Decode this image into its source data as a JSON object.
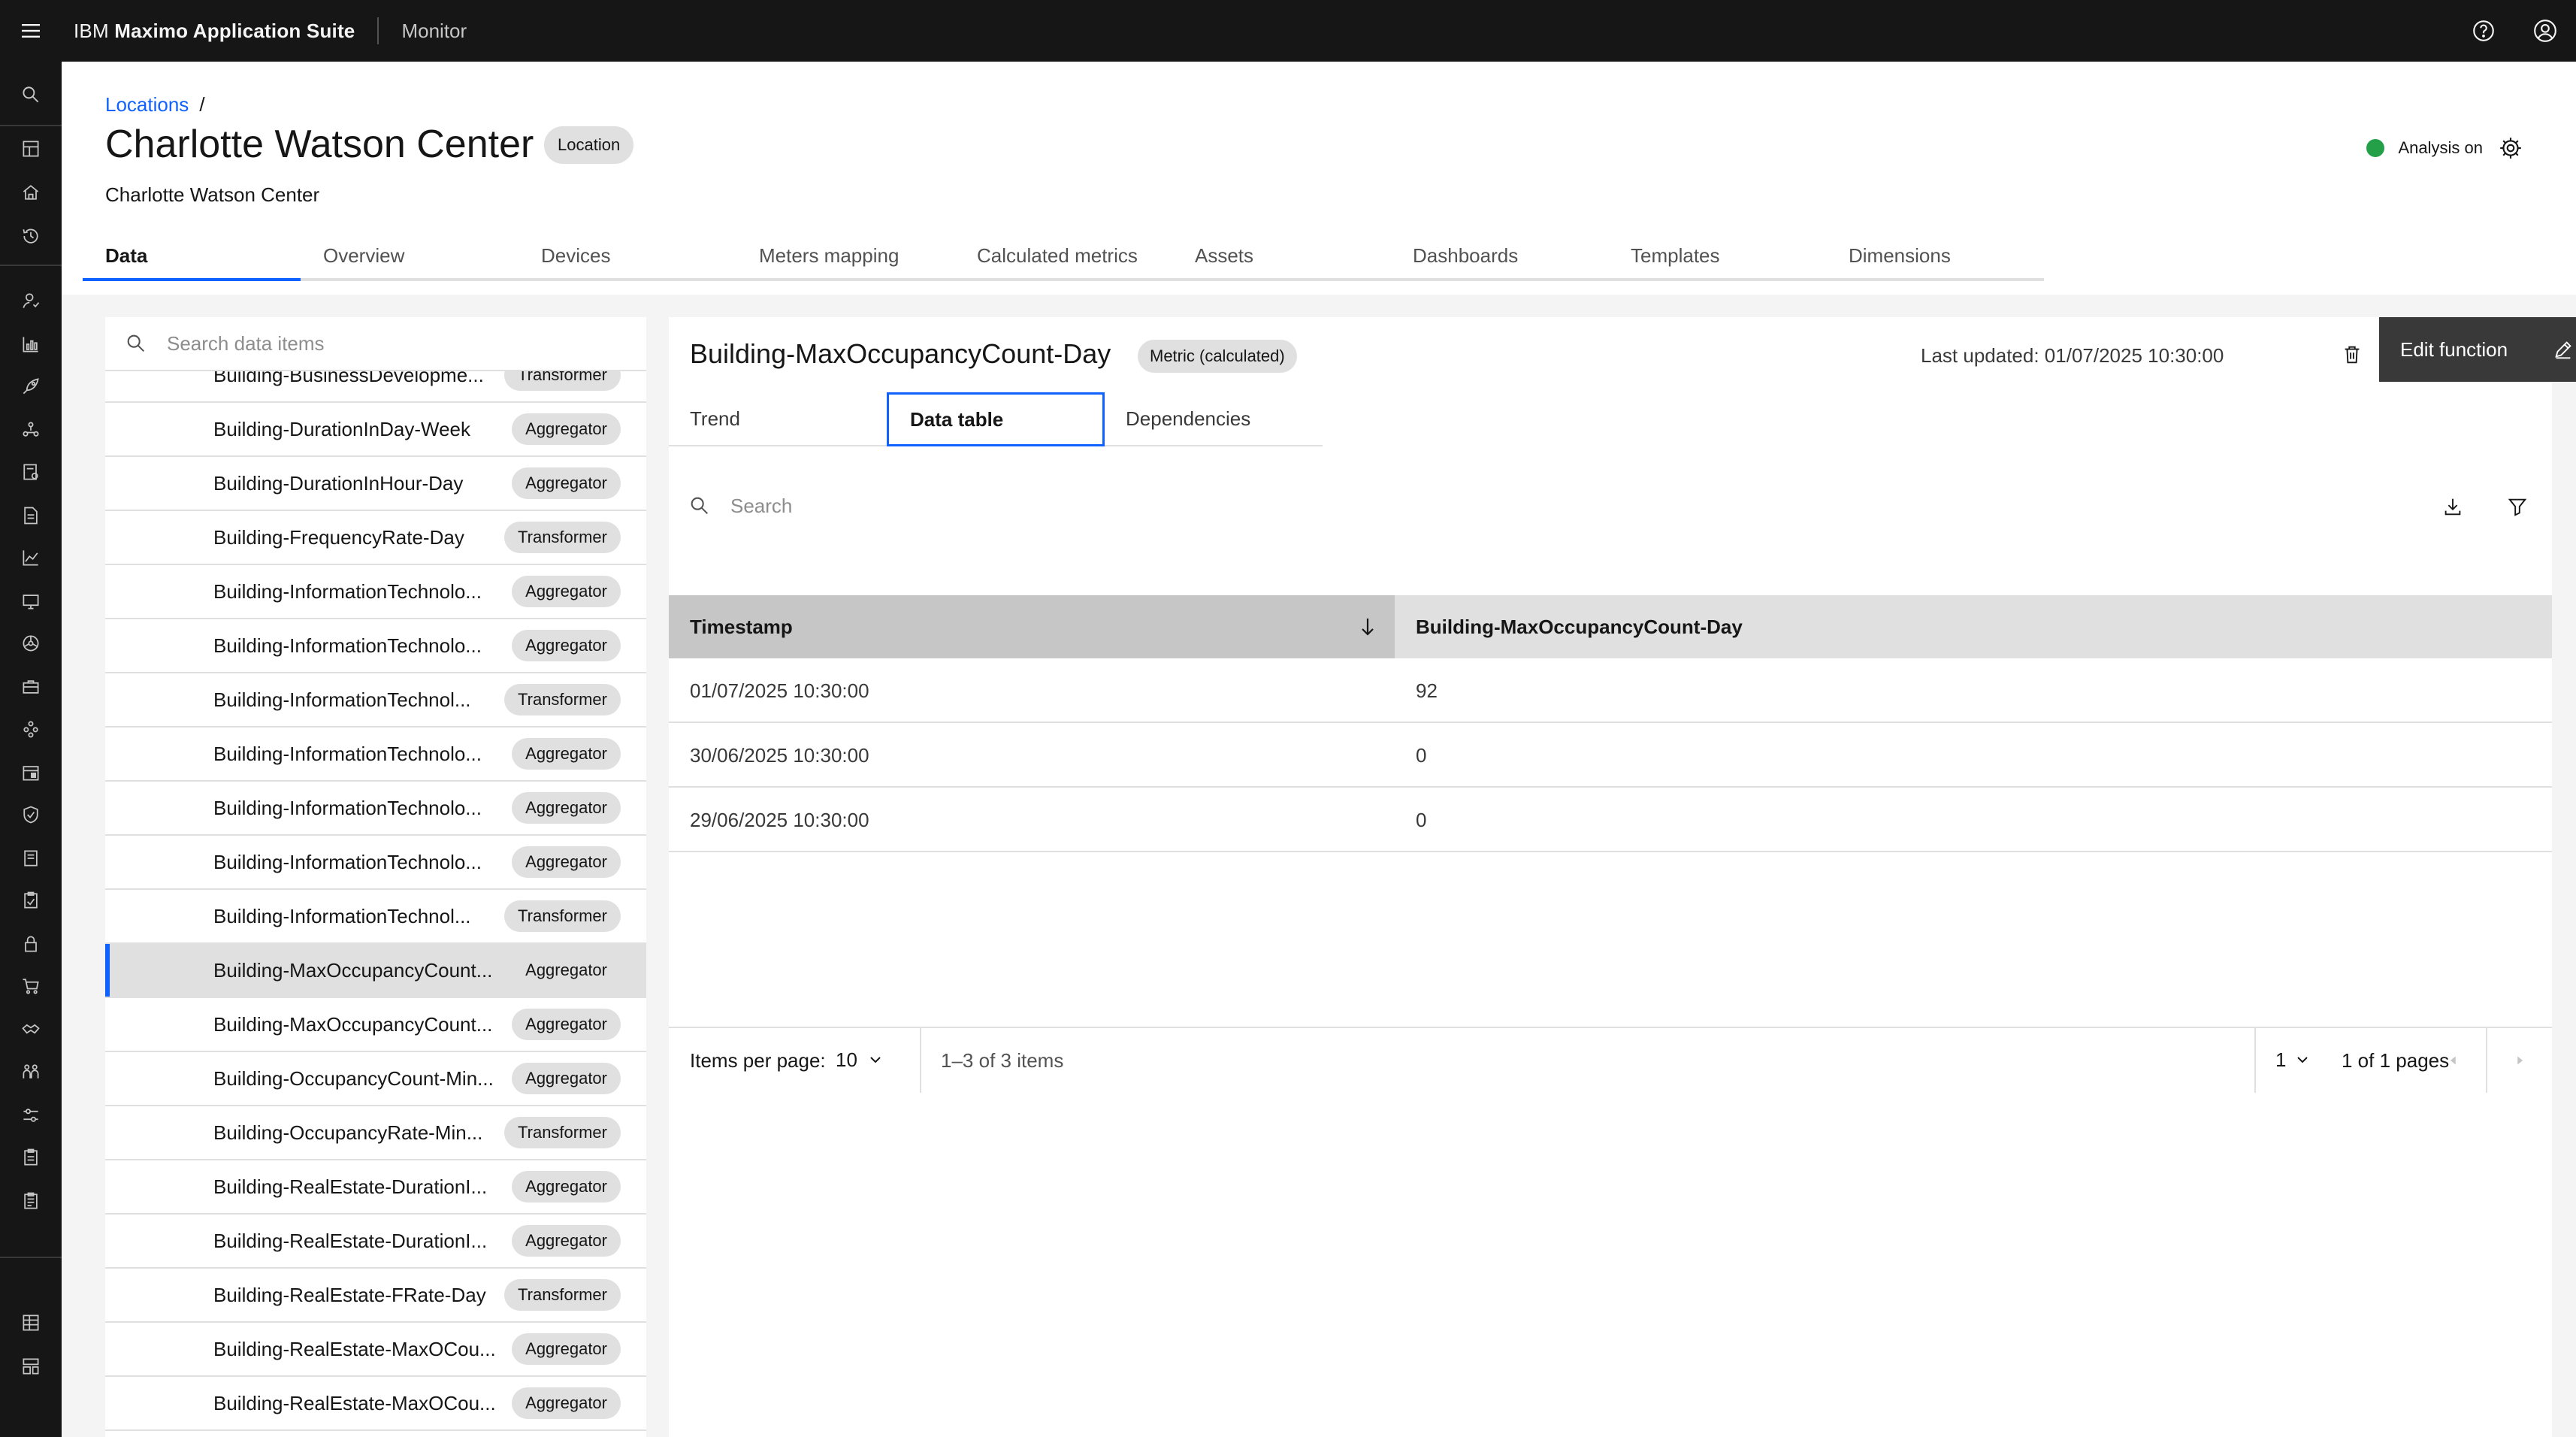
{
  "header": {
    "brand_prefix": "IBM",
    "brand_name": "Maximo Application Suite",
    "product": "Monitor"
  },
  "page": {
    "breadcrumb": "Locations",
    "breadcrumb_sep": "/",
    "title": "Charlotte Watson Center",
    "title_tag": "Location",
    "subtitle": "Charlotte Watson Center",
    "analysis_label": "Analysis on",
    "analysis_color": "#24a148"
  },
  "tabs": [
    {
      "label": "Data"
    },
    {
      "label": "Overview"
    },
    {
      "label": "Devices"
    },
    {
      "label": "Meters mapping"
    },
    {
      "label": "Calculated metrics"
    },
    {
      "label": "Assets"
    },
    {
      "label": "Dashboards"
    },
    {
      "label": "Templates"
    },
    {
      "label": "Dimensions"
    }
  ],
  "data_list": {
    "search_placeholder": "Search data items",
    "items": [
      {
        "name": "Building-BusinessDevelopme...",
        "type": "Transformer"
      },
      {
        "name": "Building-DurationInDay-Week",
        "type": "Aggregator"
      },
      {
        "name": "Building-DurationInHour-Day",
        "type": "Aggregator"
      },
      {
        "name": "Building-FrequencyRate-Day",
        "type": "Transformer"
      },
      {
        "name": "Building-InformationTechnolo...",
        "type": "Aggregator"
      },
      {
        "name": "Building-InformationTechnolo...",
        "type": "Aggregator"
      },
      {
        "name": "Building-InformationTechnol...",
        "type": "Transformer"
      },
      {
        "name": "Building-InformationTechnolo...",
        "type": "Aggregator"
      },
      {
        "name": "Building-InformationTechnolo...",
        "type": "Aggregator"
      },
      {
        "name": "Building-InformationTechnolo...",
        "type": "Aggregator"
      },
      {
        "name": "Building-InformationTechnol...",
        "type": "Transformer"
      },
      {
        "name": "Building-MaxOccupancyCount...",
        "type": "Aggregator"
      },
      {
        "name": "Building-MaxOccupancyCount...",
        "type": "Aggregator"
      },
      {
        "name": "Building-OccupancyCount-Min...",
        "type": "Aggregator"
      },
      {
        "name": "Building-OccupancyRate-Min...",
        "type": "Transformer"
      },
      {
        "name": "Building-RealEstate-DurationI...",
        "type": "Aggregator"
      },
      {
        "name": "Building-RealEstate-DurationI...",
        "type": "Aggregator"
      },
      {
        "name": "Building-RealEstate-FRate-Day",
        "type": "Transformer"
      },
      {
        "name": "Building-RealEstate-MaxOCou...",
        "type": "Aggregator"
      },
      {
        "name": "Building-RealEstate-MaxOCou...",
        "type": "Aggregator"
      }
    ]
  },
  "detail": {
    "metric_name": "Building-MaxOccupancyCount-Day",
    "metric_tag": "Metric (calculated)",
    "last_updated": "Last updated: 01/07/2025 10:30:00",
    "edit_label": "Edit function",
    "sub_tabs": [
      {
        "label": "Trend"
      },
      {
        "label": "Data table"
      },
      {
        "label": "Dependencies"
      }
    ],
    "table_search_placeholder": "Search",
    "columns": [
      "Timestamp",
      "Building-MaxOccupancyCount-Day"
    ],
    "rows": [
      {
        "timestamp": "01/07/2025 10:30:00",
        "value": "92"
      },
      {
        "timestamp": "30/06/2025 10:30:00",
        "value": "0"
      },
      {
        "timestamp": "29/06/2025 10:30:00",
        "value": "0"
      }
    ],
    "pagination": {
      "items_per_page_label": "Items per page:",
      "items_per_page": "10",
      "range_text": "1–3 of 3 items",
      "current_page": "1",
      "pages_text": "1 of 1 pages"
    }
  }
}
